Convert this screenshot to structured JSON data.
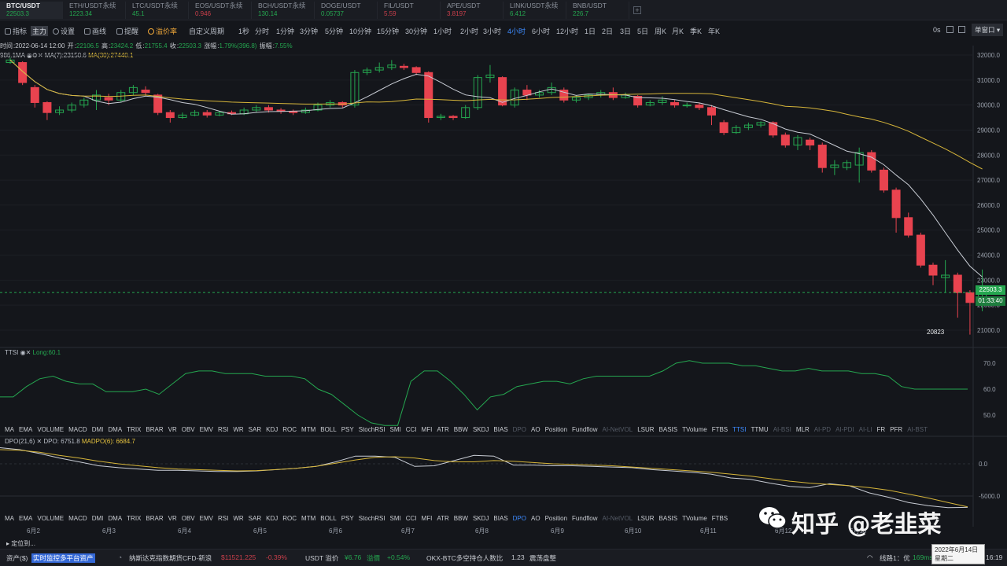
{
  "tickers": [
    {
      "name": "BTC/USDT",
      "price": "22503.3",
      "dir": "up",
      "active": true
    },
    {
      "name": "ETH/USDT永续",
      "price": "1223.34",
      "dir": "up"
    },
    {
      "name": "LTC/USDT永续",
      "price": "45.1",
      "dir": "up"
    },
    {
      "name": "EOS/USDT永续",
      "price": "0.946",
      "dir": "down"
    },
    {
      "name": "BCH/USDT永续",
      "price": "130.14",
      "dir": "up"
    },
    {
      "name": "DOGE/USDT",
      "price": "0.05737",
      "dir": "up"
    },
    {
      "name": "FIL/USDT",
      "price": "5.59",
      "dir": "down"
    },
    {
      "name": "APE/USDT",
      "price": "3.8197",
      "dir": "down"
    },
    {
      "name": "LINK/USDT永续",
      "price": "6.412",
      "dir": "up"
    },
    {
      "name": "BNB/USDT",
      "price": "226.7",
      "dir": "up"
    }
  ],
  "add_tab": "+",
  "toolbar": {
    "indicator": "指标",
    "main_badge": "主力",
    "settings": "设置",
    "drawing": "画线",
    "alert": "提醒",
    "premium": "溢价率",
    "custom_period": "自定义周期",
    "periods": [
      "1秒",
      "分时",
      "1分钟",
      "3分钟",
      "5分钟",
      "10分钟",
      "15分钟",
      "30分钟",
      "1小时",
      "2小时",
      "3小时",
      "4小时",
      "6小时",
      "12小时",
      "1日",
      "2日",
      "3日",
      "5日",
      "周K",
      "月K",
      "季K",
      "年K"
    ],
    "active_period": "4小时",
    "zero_s": "0s",
    "layout": "单窗口"
  },
  "info": {
    "time_label": "时间",
    "time": "2022-06-14 12:00",
    "open_label": "开",
    "open": "22106.5",
    "high_label": "高",
    "high": "23424.2",
    "low_label": "低",
    "low": "21755.4",
    "close_label": "收",
    "close": "22503.3",
    "change_label": "涨幅",
    "change": "1.79%(396.8)",
    "amp_label": "振幅",
    "amp": "7.55%"
  },
  "ma": {
    "left": "986.1MA",
    "ma7": "MA(7):23150.6",
    "ma30": "MA(30):27440.1"
  },
  "price_axis": [
    "32000.0",
    "31000.0",
    "30000.0",
    "29000.0",
    "28000.0",
    "27000.0",
    "26000.0",
    "25000.0",
    "24000.0",
    "23000.0",
    "22000.0",
    "21000.0"
  ],
  "current_price": "22503.3",
  "countdown": "01:33:40",
  "low_marker": "20823",
  "ttsi": {
    "name": "TTSI",
    "long": "Long:60.1",
    "axis": [
      "70.0",
      "60.0",
      "50.0"
    ]
  },
  "indicators": [
    "MA",
    "EMA",
    "VOLUME",
    "MACD",
    "DMI",
    "DMA",
    "TRIX",
    "BRAR",
    "VR",
    "OBV",
    "EMV",
    "RSI",
    "WR",
    "SAR",
    "KDJ",
    "ROC",
    "MTM",
    "BOLL",
    "PSY",
    "StochRSI",
    "SMI",
    "CCI",
    "MFI",
    "ATR",
    "BBW",
    "SKDJ",
    "BIAS",
    "DPO",
    "AO",
    "Position",
    "Fundflow",
    "AI-NetVOL",
    "LSUR",
    "BASIS",
    "TVolume",
    "FTBS",
    "TTSI",
    "TTMU",
    "AI-BSI",
    "MLR",
    "AI-PD",
    "AI-PDI",
    "AI-LI",
    "FR",
    "PFR",
    "AI-BST"
  ],
  "indicators_dim": [
    "DPO",
    "AI-NetVOL",
    "AI-BSI",
    "AI-PD",
    "AI-PDI",
    "AI-LI",
    "AI-BST"
  ],
  "indicators2": [
    "MA",
    "EMA",
    "VOLUME",
    "MACD",
    "DMI",
    "DMA",
    "TRIX",
    "BRAR",
    "VR",
    "OBV",
    "EMV",
    "RSI",
    "WR",
    "SAR",
    "KDJ",
    "ROC",
    "MTM",
    "BOLL",
    "PSY",
    "StochRSI",
    "SMI",
    "CCI",
    "MFI",
    "ATR",
    "BBW",
    "SKDJ",
    "BIAS",
    "DPO",
    "AO",
    "Position",
    "Fundflow",
    "AI-NetVOL",
    "LSUR",
    "BASIS",
    "TVolume",
    "FTBS"
  ],
  "dpo": {
    "name": "DPO(21,6)",
    "value": "DPO: 6751.8",
    "madpo": "MADPO(6): 6684.7",
    "axis": [
      "0.0",
      "-5000.0"
    ]
  },
  "dates": [
    "6月2",
    "6月3",
    "6月4",
    "6月5",
    "6月6",
    "6月7",
    "6月8",
    "6月9",
    "6月10",
    "6月11",
    "6月12",
    "6月13"
  ],
  "locate": "定位到...",
  "status": {
    "assets": "资产($)",
    "monitor": "实时监控多平台资产",
    "nasdaq": "纳斯达克指数期货CFD-新浪",
    "nasdaq_price": "$11521.225",
    "nasdaq_chg": "-0.39%",
    "usdt_label": "USDT 溢价",
    "usdt_price": "¥6.76",
    "premium_label": "溢價",
    "premium_chg": "+0.54%",
    "okx": "OKX-BTC多空持仓人数比",
    "okx_val": "1.23",
    "okx_state": "震荡盘整",
    "line": "线路1：优",
    "ms": "169ms",
    "time": "16:19"
  },
  "tooltip": {
    "date": "2022年6月14日",
    "weekday": "星期二"
  },
  "watermark": "知乎 @老韭菜",
  "colors": {
    "up": "#25a750",
    "down": "#e8434f",
    "ma7": "#c8ccd4",
    "ma30": "#d6b53a",
    "accent": "#3d8bff"
  }
}
